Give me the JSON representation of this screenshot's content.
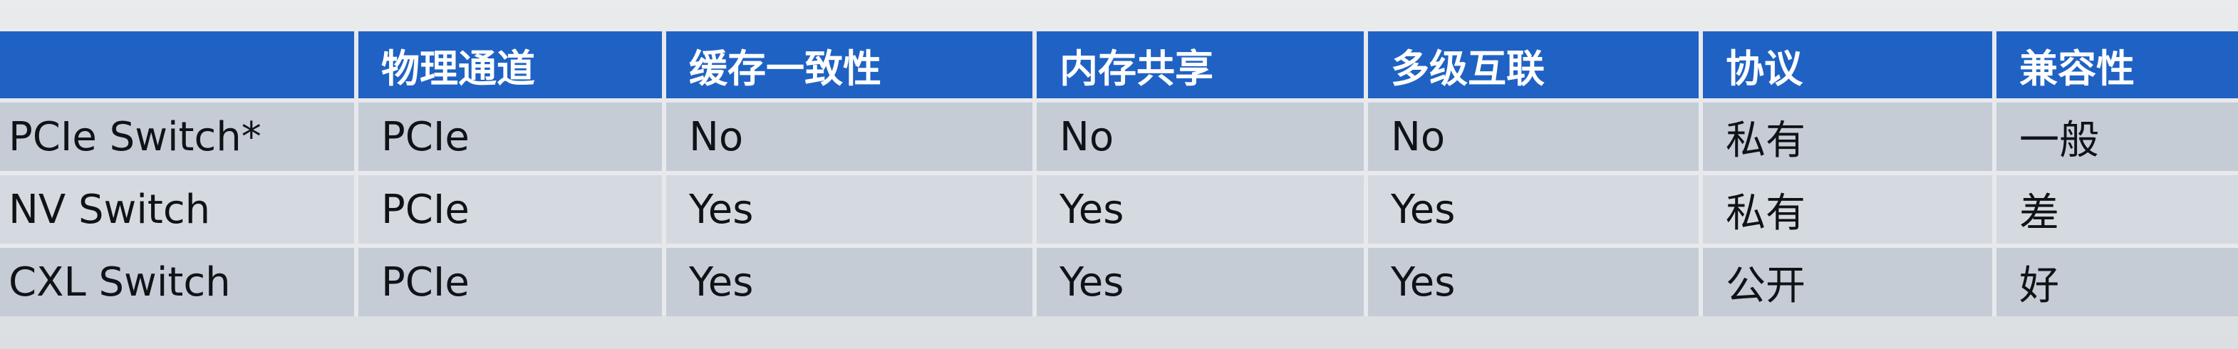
{
  "table": {
    "headers": [
      "",
      "物理通道",
      "缓存一致性",
      "内存共享",
      "多级互联",
      "协议",
      "兼容性"
    ],
    "rows": [
      [
        "PCIe Switch*",
        "PCIe",
        "No",
        "No",
        "No",
        "私有",
        "一般"
      ],
      [
        "NV Switch",
        "PCIe",
        "Yes",
        "Yes",
        "Yes",
        "私有",
        "差"
      ],
      [
        "CXL Switch",
        "PCIe",
        "Yes",
        "Yes",
        "Yes",
        "公开",
        "好"
      ]
    ]
  },
  "colors": {
    "header_bg": "#1f62c4",
    "header_text": "#ffffff",
    "row_bg_dark": "#c5ccd6",
    "row_bg_light": "#d5dae1",
    "page_bg": "#e3e5e7"
  }
}
